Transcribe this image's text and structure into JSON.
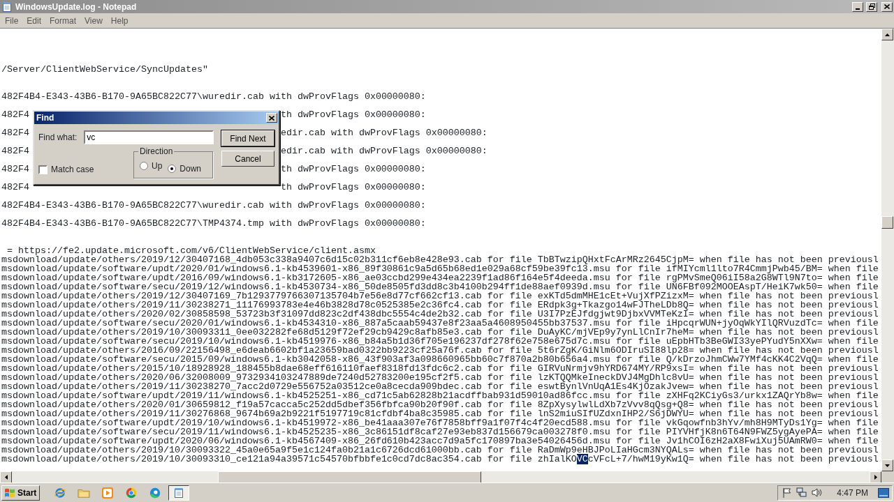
{
  "window": {
    "title": "WindowsUpdate.log - Notepad"
  },
  "menu": [
    "File",
    "Edit",
    "Format",
    "View",
    "Help"
  ],
  "lines": [
    {
      "kind": "blank"
    },
    {
      "kind": "blank"
    },
    {
      "kind": "blank"
    },
    {
      "kind": "blank"
    },
    {
      "kind": "text",
      "text": "/Server/ClientWebService/SyncUpdates\""
    },
    {
      "kind": "blank"
    },
    {
      "kind": "blank"
    },
    {
      "kind": "text",
      "text": "482F4B4-E343-43B6-B170-9A65BC822C77\\wuredir.cab with dwProvFlags 0x00000080:"
    },
    {
      "kind": "blank"
    },
    {
      "kind": "split",
      "left": "482F4",
      "right": "th dwProvFlags 0x00000080:"
    },
    {
      "kind": "blank"
    },
    {
      "kind": "split",
      "left": "482F4",
      "right": "edir.cab with dwProvFlags 0x00000080:"
    },
    {
      "kind": "blank"
    },
    {
      "kind": "split",
      "left": "482F4",
      "right": "edir.cab with dwProvFlags 0x00000080:"
    },
    {
      "kind": "blank"
    },
    {
      "kind": "split",
      "left": "482F4",
      "right": "th dwProvFlags 0x00000080:"
    },
    {
      "kind": "blank"
    },
    {
      "kind": "split",
      "left": "482F4",
      "right": "th dwProvFlags 0x00000080:"
    },
    {
      "kind": "blank"
    },
    {
      "kind": "text",
      "text": "482F4B4-E343-43B6-B170-9A65BC822C77\\wuredir.cab with dwProvFlags 0x00000080:"
    },
    {
      "kind": "blank"
    },
    {
      "kind": "text",
      "text": "482F4B4-E343-43B6-B170-9A65BC822C77\\TMP4374.tmp with dwProvFlags 0x00000080:"
    },
    {
      "kind": "blank"
    },
    {
      "kind": "blank"
    },
    {
      "kind": "text",
      "text": " = https://fe2.update.microsoft.com/v6/ClientWebService/client.asmx"
    },
    {
      "kind": "text",
      "text": "msdownload/update/others/2019/12/30407168_4db053c338a9407c6d15c02b311cf6eb8e428e93.cab for file TbBTwzipQHxtFcArMRz2645CjpM= when file has not been previousl"
    },
    {
      "kind": "text",
      "text": "msdownload/update/software/updt/2020/01/windows6.1-kb4539601-x86_89f30861c9a5d65b68ed1e029a68cf59be39fc13.msu for file ifMIYcml1lto7R4CmmjPwb45/BM= when file"
    },
    {
      "kind": "text",
      "text": "msdownload/update/software/updt/2016/09/windows6.1-kb3172605-x86_ae03ccbd299e434ea2239f1ad86f164e5f4deeda.msu for file rgPMvSmeQ06iI58a2G8WTl9N7to= when file"
    },
    {
      "kind": "text",
      "text": "msdownload/update/software/secu/2019/12/windows6.1-kb4530734-x86_50de8505fd3dd8c3b4100b294ff1de88aef0939d.msu for file UN6FBf092MOOEAspT/HeiK7wk50= when file"
    },
    {
      "kind": "text",
      "text": "msdownload/update/others/2019/12/30407169_7b1293779766307135704b7e56e8d77cf662cf13.cab for file exKTd5dmMHE1cEt+VujXfPZizxM= when file has not been previousl"
    },
    {
      "kind": "text",
      "text": "msdownload/update/others/2019/11/30238271_11176993783e4e46b3828d78c0525385e2c36fc4.cab for file ERdpk3g+Tkazgo14wFJTheLDb8Q= when file has not been previousl"
    },
    {
      "kind": "text",
      "text": "msdownload/update/others/2020/02/30858598_53723b3f31097dd823c2df438dbc5554c4de2b32.cab for file U3I7PzEJfdgjwt9DjbxVVMTeKzI= when file has not been previousl"
    },
    {
      "kind": "text",
      "text": "msdownload/update/software/secu/2020/01/windows6.1-kb4534310-x86_887a5caab59437e8f23aa5a4608950455bb37537.msu for file iHpcqrWUN+jyOqWkYIlQRVuzdTc= when file"
    },
    {
      "kind": "text",
      "text": "msdownload/update/others/2019/10/30093311_0ee032282fe68d5129f72ef29cb9429c8afb85e3.cab for file DuAyKC/mjVEp9y7ynLlCnIr7heM= when file has not been previousl"
    },
    {
      "kind": "text",
      "text": "msdownload/update/software/secu/2019/10/windows6.1-kb4519976-x86_b84a5b1d36f705e196237df278f62e758e675d7c.msu for file uEpbHTb3BeGWI33yePYudY5nXXw= when file"
    },
    {
      "kind": "text",
      "text": "msdownload/update/others/2016/09/22156498_e6deab6602bf1a23659bad0322bb9223cf25a76f.cab for file 5t6rZgK/GiNlm6ODIruSI88lp28= when file has not been previousl"
    },
    {
      "kind": "text",
      "text": "msdownload/update/software/secu/2015/09/windows6.1-kb3042058-x86_43f903af3a098660965bb60c7f870a2b80b656a4.msu for file Q/kDrzoJhmCWw7YMf4cKK4C2VqQ= when file"
    },
    {
      "kind": "text",
      "text": "msdownload/update/others/2015/10/18928928_188455b8dae68eff616110faef8318fd13fdc6c2.cab for file GIRVuNrmjv9hYRD674MY/RP9xsI= when file has not been previousl"
    },
    {
      "kind": "text",
      "text": "msdownload/update/others/2020/06/32008009_9732934103247889de7240d52783200e195cf2f5.cab for file lzKTQQMkeIneckDVJ4MgDhlc8vU= when file has not been previousl"
    },
    {
      "kind": "text",
      "text": "msdownload/update/others/2019/11/30238270_7acc2d0729e556752a03512ce0a8cecda909bdec.cab for file eswtBynlVnUqA1Es4KjOzakJvew= when file has not been previousl"
    },
    {
      "kind": "text",
      "text": "msdownload/update/software/updt/2019/11/windows6.1-kb4525251-x86_cd71c5ab62828b21acdffbab931d59010ad86fcc.msu for file zXHFq2KCiyGs3/urkx1ZAQrYb8w= when file"
    },
    {
      "kind": "text",
      "text": "msdownload/update/others/2020/01/30659812_f19a57cacca5c252dd5dbef356fbfca90b20f90f.cab for file 8ZpXysylwlLdXb7zVvv8qQsg+Q8= when file has not been previousl"
    },
    {
      "kind": "text",
      "text": "msdownload/update/others/2019/11/30276868_9674b69a2b9221f5197719c81cfdbf4ba8c35985.cab for file lnS2miuSIfUZdxnIHP2/S6jDWYU= when file has not been previousl"
    },
    {
      "kind": "text",
      "text": "msdownload/update/software/updt/2019/10/windows6.1-kb4519972-x86_be41aaa307e76f7858bff9a1f07f4c4f20ecd588.msu for file vkGqowfnb3hYv/mh8H9MTyDs1Yg= when file"
    },
    {
      "kind": "text",
      "text": "msdownload/update/software/secu/2019/11/windows6.1-kb4525235-x86_3c86151df8caf27e93eb837d156679ca003278f0.msu for file PIYVHfjK8n6T64N9FWZ5ygAyePA= when file"
    },
    {
      "kind": "text",
      "text": "msdownload/update/software/updt/2020/06/windows6.1-kb4567409-x86_26fd610b423acc7d9a5fc170897ba3e54026456d.msu for file Jv1hCOI6zH2aX8FwiXuj5UAmRW0= when file"
    },
    {
      "kind": "text",
      "text": "msdownload/update/others/2019/10/30093322_45a0e65a9f5e1c124fa0b21a1c6726dcd61000bb.cab for file RaDmWp9eHBJPoLIaHGcm3NYQALs= when file has not been previousl"
    },
    {
      "kind": "selection",
      "spans": [
        {
          "text": "msdownload/update/others/2019/10/30093310_ce121a94a39571c54570bfbbfe1c0cd7dc8ac354.cab for file zhIalKO",
          "selected": false
        },
        {
          "text": "VC",
          "selected": true
        },
        {
          "text": "cVFcL+7/hwM19yKw1Q= when file has not been previousl",
          "selected": false
        }
      ]
    }
  ],
  "find_dialog": {
    "title": "Find",
    "find_what_label": "Find what:",
    "find_what_value": "vc",
    "buttons": [
      {
        "label": "Find Next",
        "default": true
      },
      {
        "label": "Cancel",
        "default": false
      }
    ],
    "direction": {
      "label": "Direction",
      "options": [
        {
          "label": "Up",
          "selected": false
        },
        {
          "label": "Down",
          "selected": true
        }
      ]
    },
    "match_case": {
      "label": "Match case",
      "checked": false
    }
  },
  "taskbar": {
    "start": "Start",
    "apps": [
      {
        "kind": "ie",
        "selected": false
      },
      {
        "kind": "folder",
        "selected": false
      },
      {
        "kind": "media",
        "selected": false
      },
      {
        "kind": "chrome",
        "selected": false
      },
      {
        "kind": "edge",
        "selected": false
      },
      {
        "kind": "notepad",
        "selected": true
      }
    ],
    "clock": "4:47 PM"
  }
}
